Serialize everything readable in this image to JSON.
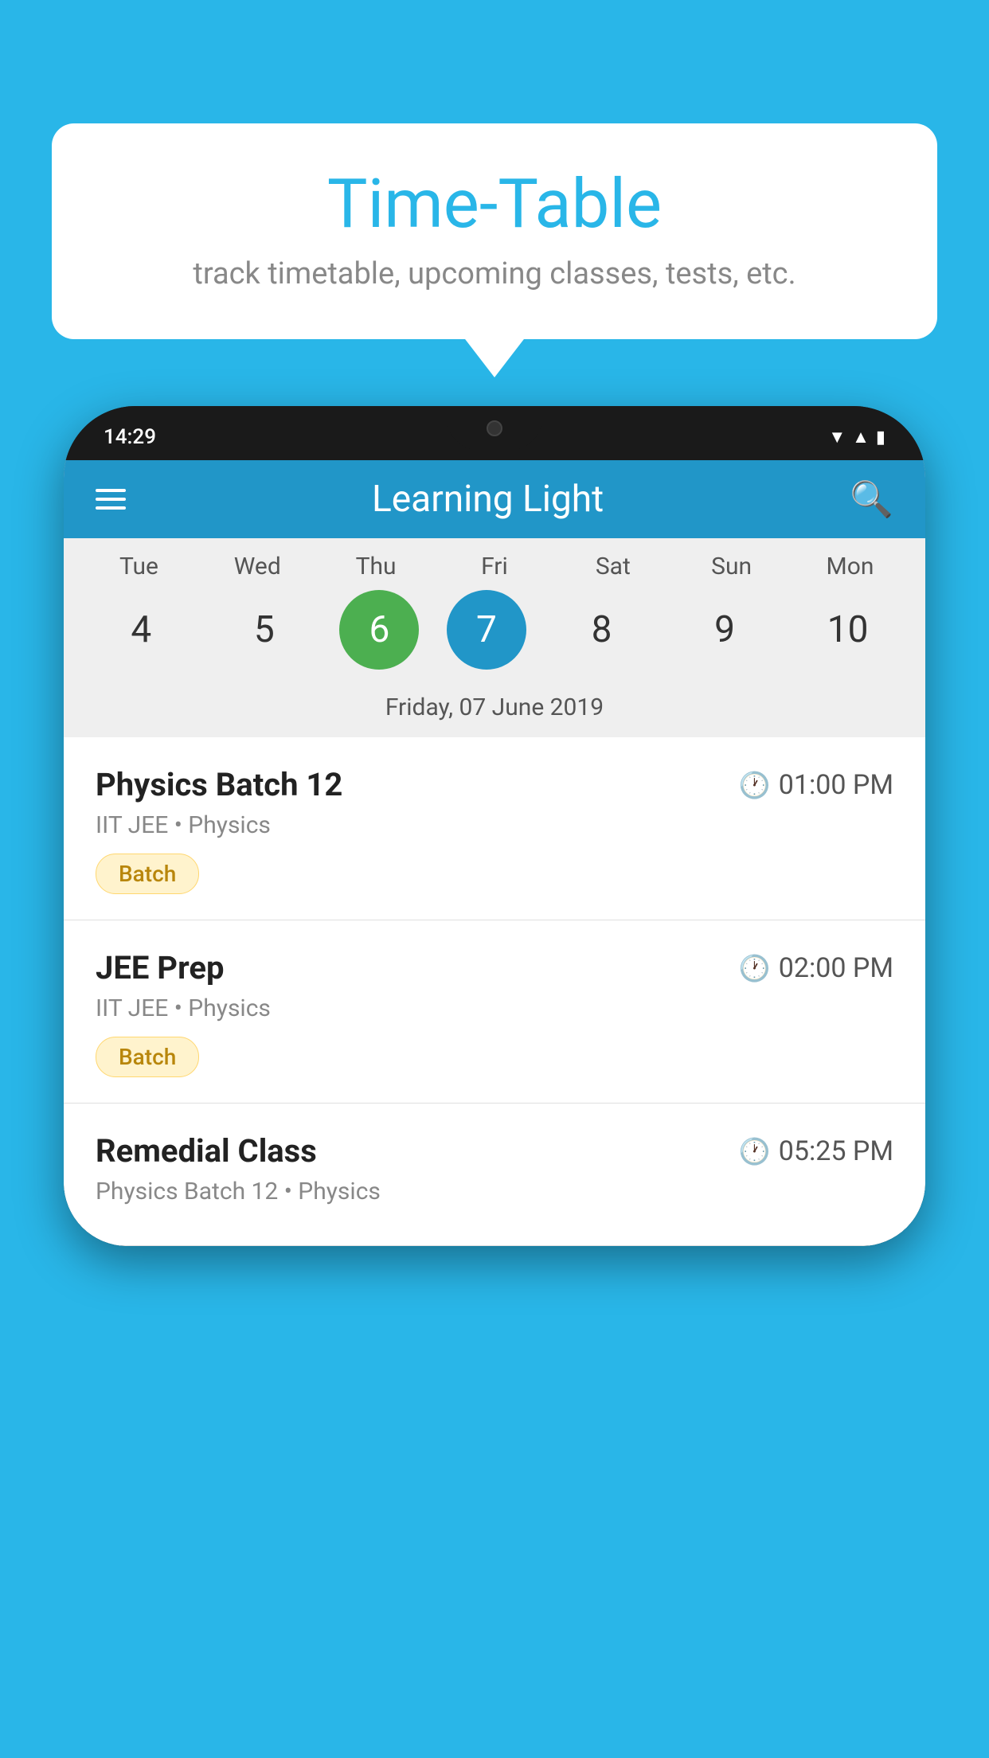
{
  "background_color": "#29B6E8",
  "speech_bubble": {
    "title": "Time-Table",
    "subtitle": "track timetable, upcoming classes, tests, etc."
  },
  "phone": {
    "status_bar": {
      "time": "14:29"
    },
    "app_header": {
      "title": "Learning Light"
    },
    "calendar": {
      "days": [
        "Tue",
        "Wed",
        "Thu",
        "Fri",
        "Sat",
        "Sun",
        "Mon"
      ],
      "dates": [
        "4",
        "5",
        "6",
        "7",
        "8",
        "9",
        "10"
      ],
      "today_index": 2,
      "selected_index": 3,
      "selected_date_label": "Friday, 07 June 2019"
    },
    "classes": [
      {
        "name": "Physics Batch 12",
        "time": "01:00 PM",
        "meta": "IIT JEE • Physics",
        "badge": "Batch"
      },
      {
        "name": "JEE Prep",
        "time": "02:00 PM",
        "meta": "IIT JEE • Physics",
        "badge": "Batch"
      },
      {
        "name": "Remedial Class",
        "time": "05:25 PM",
        "meta": "Physics Batch 12 • Physics",
        "badge": null
      }
    ]
  }
}
